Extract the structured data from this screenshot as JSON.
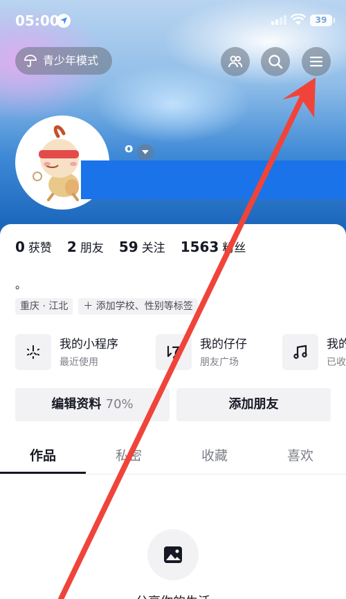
{
  "status_bar": {
    "time": "05:00",
    "battery": "39"
  },
  "header": {
    "teen_mode_label": "青少年模式",
    "friends_icon": "friends-icon",
    "search_icon": "search-icon",
    "menu_icon": "menu-icon"
  },
  "profile": {
    "name": "o",
    "bio": "。"
  },
  "stats": [
    {
      "value": "0",
      "label": "获赞"
    },
    {
      "value": "2",
      "label": "朋友"
    },
    {
      "value": "59",
      "label": "关注"
    },
    {
      "value": "1563",
      "label": "粉丝"
    }
  ],
  "tags": [
    "重庆 · 江北",
    "＋ 添加学校、性别等标签"
  ],
  "shortcuts": [
    {
      "title": "我的小程序",
      "subtitle": "最近使用",
      "icon": "mini-program-icon"
    },
    {
      "title": "我的仔仔",
      "subtitle": "朋友广场",
      "icon": "zaizai-icon"
    },
    {
      "title": "我的",
      "subtitle": "已收",
      "icon": "music-note-icon"
    }
  ],
  "actions": {
    "edit_label": "编辑资料",
    "edit_percent": "70%",
    "add_friend_label": "添加朋友"
  },
  "tabs": [
    "作品",
    "私密",
    "收藏",
    "喜欢"
  ],
  "active_tab": "作品",
  "empty_state": {
    "text": "分享你的生活"
  },
  "colors": {
    "accent": "#161823",
    "annotation_arrow": "#f0443a",
    "redaction": "#1a73e8"
  }
}
